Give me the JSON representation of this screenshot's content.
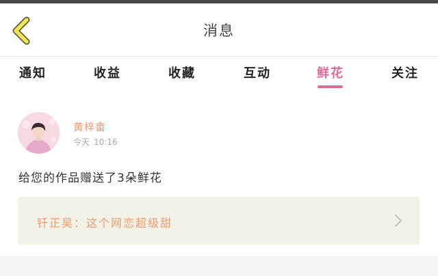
{
  "header": {
    "title": "消息",
    "back_icon": "chevron-left-icon",
    "back_color": "#e8d84a"
  },
  "tabs": [
    {
      "label": "通知"
    },
    {
      "label": "收益"
    },
    {
      "label": "收藏"
    },
    {
      "label": "互动"
    },
    {
      "label": "鲜花",
      "active": true
    },
    {
      "label": "关注"
    }
  ],
  "accent_color": "#e06a9a",
  "message": {
    "sender": "黄梓畬",
    "date": "今天",
    "time": "10:16",
    "text": "给您的作品赠送了3朵鲜花",
    "quoted": "钎正昊：这个网恋超级甜",
    "quoted_icon": "chevron-right-icon"
  }
}
